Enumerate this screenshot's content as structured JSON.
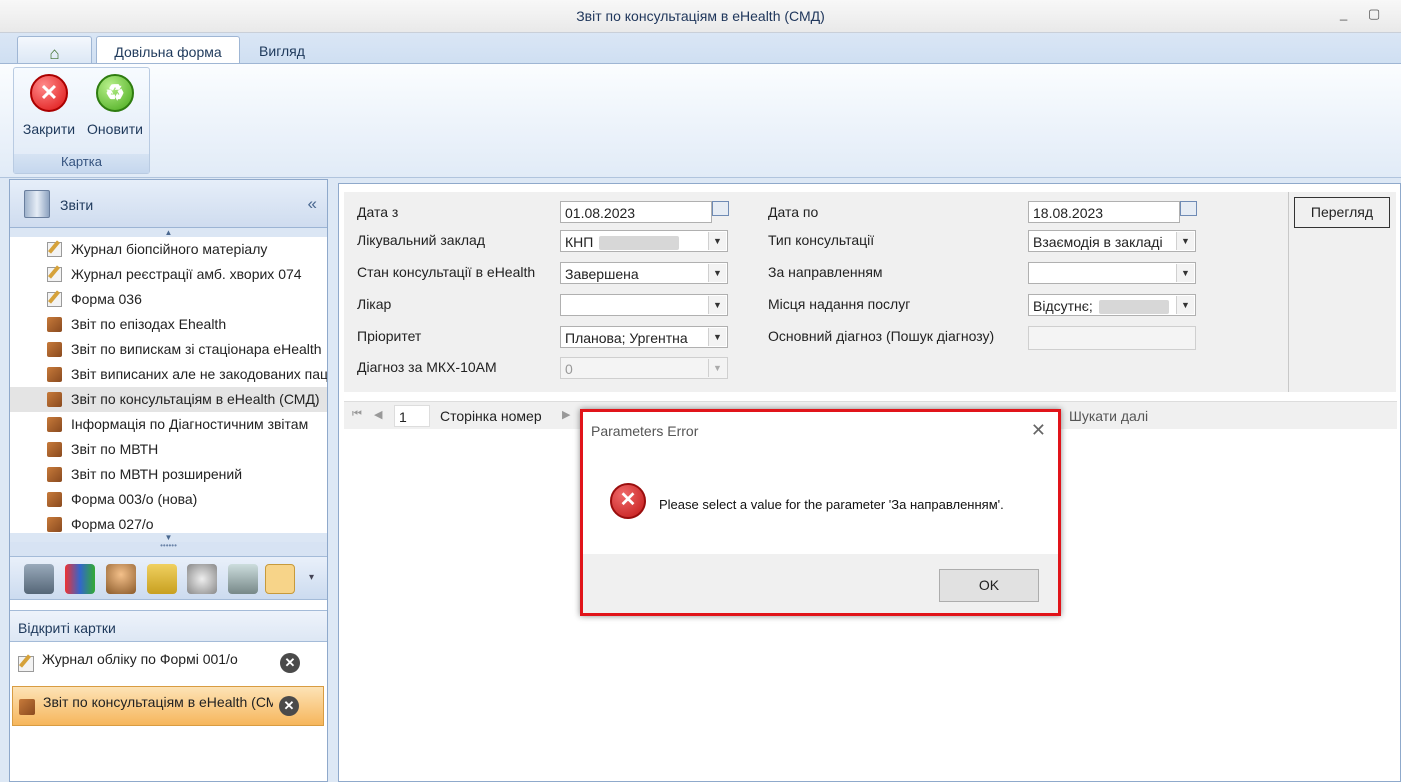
{
  "window": {
    "title": "Звіт по консультаціям в eHealth (СМД)",
    "minimize": "_",
    "maximize": "▢"
  },
  "tabs": {
    "home": "⌂",
    "form": "Довільна форма",
    "view": "Вигляд"
  },
  "ribbon": {
    "close_label": "Закрити",
    "refresh_label": "Оновити",
    "group_label": "Картка"
  },
  "left": {
    "header": "Звіти",
    "collapse": "«",
    "items": [
      {
        "label": "Журнал біопсійного матеріалу",
        "icon": "edit-icon"
      },
      {
        "label": "Журнал реєстрації амб. хворих 074",
        "icon": "edit-icon"
      },
      {
        "label": "Форма 036",
        "icon": "edit-icon"
      },
      {
        "label": "Звіт по епізодах Ehealth",
        "icon": "report-icon"
      },
      {
        "label": "Звіт по випискам зі стаціонара eHealth",
        "icon": "report-icon"
      },
      {
        "label": "Звіт виписаних але не закодованих пацієнтів",
        "icon": "report-icon"
      },
      {
        "label": "Звіт по консультаціям в eHealth (СМД)",
        "icon": "report-icon"
      },
      {
        "label": "Інформація по Діагностичним звітам",
        "icon": "report-icon"
      },
      {
        "label": "Звіт по МВТН",
        "icon": "report-icon"
      },
      {
        "label": "Звіт по МВТН розширений",
        "icon": "report-icon"
      },
      {
        "label": "Форма 003/о (нова)",
        "icon": "report-icon"
      },
      {
        "label": "Форма 027/о",
        "icon": "report-icon"
      }
    ],
    "open_cards_header": "Відкриті картки",
    "open_cards": [
      {
        "label": "Журнал обліку по Формі 001/о"
      },
      {
        "label": "Звіт по консультаціям в eHealth (СМД)"
      }
    ]
  },
  "params": {
    "date_from_label": "Дата з",
    "date_from": "01.08.2023",
    "date_to_label": "Дата по",
    "date_to": "18.08.2023",
    "facility_label": "Лікувальний заклад",
    "facility": "КНП",
    "consult_type_label": "Тип консультації",
    "consult_type": "Взаємодія в закладі",
    "status_label": "Стан консультації в eHealth",
    "status": "Завершена",
    "referral_label": "За направленням",
    "referral": "",
    "doctor_label": "Лікар",
    "doctor": "",
    "place_label": "Місця надання послуг",
    "place": "Відсутнє;",
    "priority_label": "Пріоритет",
    "priority": "Планова; Ургентна",
    "main_dx_label": "Основний діагноз (Пошук діагнозу)",
    "main_dx": "",
    "icd_label": "Діагноз за МКХ-10АМ",
    "icd": "0",
    "view_button": "Перегляд"
  },
  "toolbar": {
    "page": "1",
    "page_label": "Сторінка номер",
    "find_next": "Шукати далі"
  },
  "dialog": {
    "title": "Parameters Error",
    "close": "✕",
    "message": "Please select a value for the parameter 'За направленням'.",
    "ok": "OK"
  }
}
